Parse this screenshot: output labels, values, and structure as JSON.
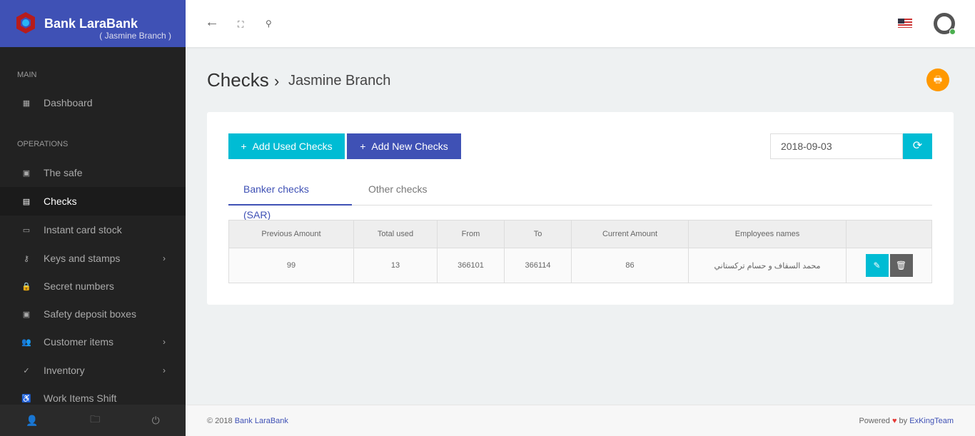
{
  "brand": {
    "title": "Bank LaraBank",
    "subtitle": "( Jasmine Branch )"
  },
  "sidebar": {
    "sections": [
      "MAIN",
      "OPERATIONS"
    ],
    "items": [
      {
        "label": "Dashboard",
        "icon": "▦"
      },
      {
        "label": "The safe",
        "icon": "▣"
      },
      {
        "label": "Checks",
        "icon": "▤"
      },
      {
        "label": "Instant card stock",
        "icon": "▭"
      },
      {
        "label": "Keys and stamps",
        "icon": "⚷"
      },
      {
        "label": "Secret numbers",
        "icon": "🔒"
      },
      {
        "label": "Safety deposit boxes",
        "icon": "▣"
      },
      {
        "label": "Customer items",
        "icon": "👥"
      },
      {
        "label": "Inventory",
        "icon": "✓"
      },
      {
        "label": "Work Items Shift",
        "icon": "♿"
      }
    ]
  },
  "page": {
    "title": "Checks",
    "chevron": "›",
    "subtitle": "Jasmine Branch"
  },
  "toolbar": {
    "add_used": "Add Used Checks",
    "add_new": "Add New Checks",
    "plus": "+",
    "date": "2018-09-03"
  },
  "tabs": [
    "Banker checks (SAR)",
    "Other checks"
  ],
  "table": {
    "headers": [
      "Previous Amount",
      "Total used",
      "From",
      "To",
      "Current Amount",
      "Employees names",
      ""
    ],
    "rows": [
      [
        "99",
        "13",
        "366101",
        "366114",
        "86",
        "محمد السقاف و حسام تركستاني"
      ]
    ]
  },
  "footer": {
    "copy": "© 2018",
    "brand": "Bank LaraBank",
    "powered": "Powered",
    "by": "by",
    "team": "ExKingTeam"
  },
  "colors": {
    "primary": "#3f51b5",
    "cyan": "#00bcd4",
    "orange": "#ff9800"
  }
}
